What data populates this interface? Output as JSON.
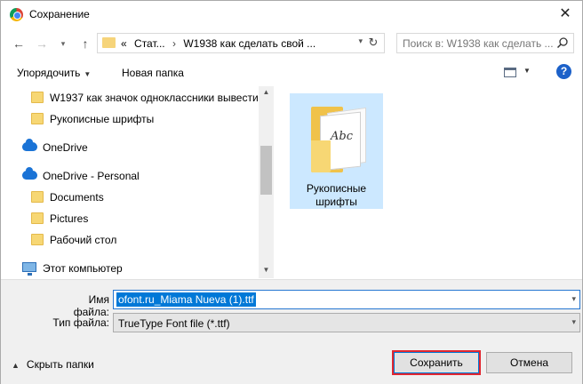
{
  "window": {
    "title": "Сохранение",
    "close_glyph": "✕"
  },
  "address": {
    "prefix": "«",
    "crumbs": [
      "Стат...",
      "W1938 как сделать свой ..."
    ],
    "separator": "›"
  },
  "search": {
    "placeholder": "Поиск в: W1938 как сделать ..."
  },
  "toolbar": {
    "organize_label": "Упорядочить",
    "new_folder_label": "Новая папка",
    "help_glyph": "?"
  },
  "nav": {
    "items": [
      {
        "label": "W1937 как значок одноклассники вывести",
        "icon": "folder-icon"
      },
      {
        "label": "Рукописные шрифты",
        "icon": "folder-icon"
      },
      {
        "label": "OneDrive",
        "icon": "cloud-icon"
      },
      {
        "label": "OneDrive - Personal",
        "icon": "cloud-icon"
      },
      {
        "label": "Documents",
        "icon": "folder-icon"
      },
      {
        "label": "Pictures",
        "icon": "folder-icon"
      },
      {
        "label": "Рабочий стол",
        "icon": "folder-icon"
      },
      {
        "label": "Этот компьютер",
        "icon": "computer-icon"
      }
    ]
  },
  "content": {
    "folder_label": "Рукописные шрифты"
  },
  "form": {
    "filename_label": "Имя файла:",
    "filename_value": "ofont.ru_Miama Nueva (1).ttf",
    "filetype_label": "Тип файла:",
    "filetype_value": "TrueType Font file (*.ttf)"
  },
  "footer": {
    "hide_folders_label": "Скрыть папки",
    "save_label": "Сохранить",
    "cancel_label": "Отмена"
  },
  "colors": {
    "selection": "#0078d7",
    "highlight_border": "#e2262f",
    "tile_selected": "#cce8ff"
  }
}
